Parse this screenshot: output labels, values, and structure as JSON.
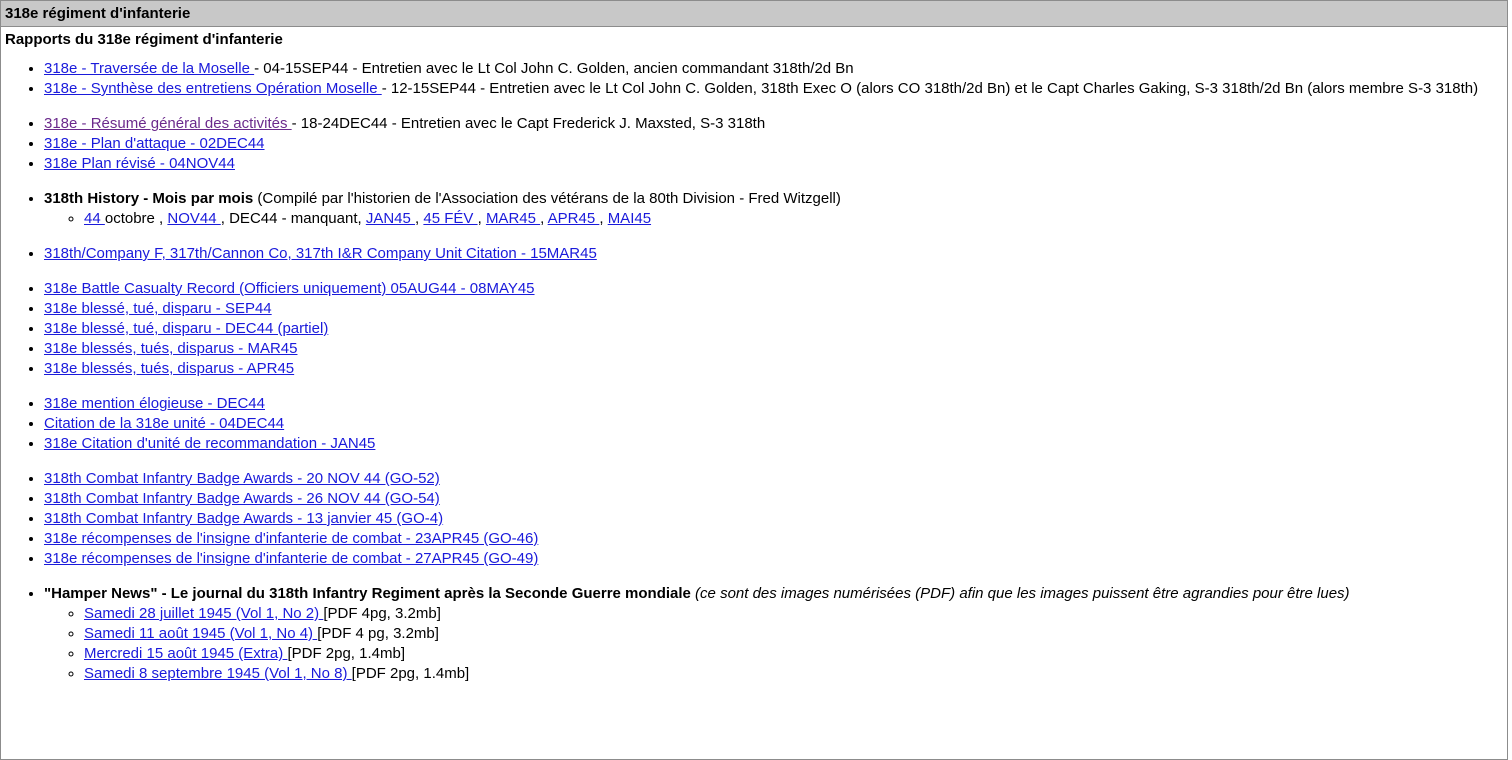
{
  "header": {
    "title": "318e régiment d'infanterie"
  },
  "section_title": "Rapports du 318e régiment d'infanterie",
  "moselle": [
    {
      "link": "318e - Traversée de la Moselle ",
      "text": "- 04-15SEP44 - Entretien avec le Lt Col John C. Golden, ancien commandant 318th/2d Bn"
    },
    {
      "link": "318e - Synthèse des entretiens Opération Moselle ",
      "text": "- 12-15SEP44 - Entretien avec le Lt Col John C. Golden, 318th Exec O (alors CO 318th/2d Bn) et le Capt Charles Gaking, S-3 318th/2d Bn (alors membre S-3 318th)"
    }
  ],
  "activities": [
    {
      "link": "318e - Résumé général des activités ",
      "text": "- 18-24DEC44 - Entretien avec le Capt Frederick J. Maxsted, S-3 318th"
    },
    {
      "link": "318e - Plan d'attaque - 02DEC44",
      "text": ""
    },
    {
      "link": "318e Plan révisé - 04NOV44",
      "text": ""
    }
  ],
  "history": {
    "title": "318th History - Mois par mois",
    "note": " (Compilé par l'historien de l'Association des vétérans de la 80th Division - Fred Witzgell)",
    "months": {
      "oct_link": "44 ",
      "oct_text": "octobre , ",
      "nov_link": "NOV44 ",
      "dec_text": ", DEC44 - manquant, ",
      "jan_link": "JAN45 ",
      "feb_link": "45 FÉV ",
      "mar_link": "MAR45 ",
      "apr_link": "APR45 ",
      "may_link": "MAI45",
      "sep": ", "
    }
  },
  "unit_citation": "318th/Company F, 317th/Cannon Co, 317th I&R Company Unit Citation - 15MAR45",
  "casualties": [
    "318e Battle Casualty Record (Officiers uniquement) 05AUG44 - 08MAY45",
    "318e blessé, tué, disparu - SEP44",
    "318e blessé, tué, disparu - DEC44 (partiel)",
    "318e blessés, tués, disparus - MAR45",
    "318e blessés, tués, disparus - APR45"
  ],
  "commendations": [
    "318e mention élogieuse - DEC44",
    "Citation de la 318e unité - 04DEC44",
    "318e Citation d'unité de recommandation - JAN45"
  ],
  "badges": [
    "318th Combat Infantry Badge Awards - 20 NOV 44 (GO-52)",
    "318th Combat Infantry Badge Awards - 26 NOV 44 (GO-54)",
    "318th Combat Infantry Badge Awards - 13 janvier 45 (GO-4)",
    "318e récompenses de l'insigne d'infanterie de combat - 23APR45 (GO-46)",
    "318e récompenses de l'insigne d'infanterie de combat - 27APR45 (GO-49)"
  ],
  "hamper": {
    "title": "\"Hamper News\" - Le journal du 318th Infantry Regiment après la Seconde Guerre mondiale",
    "note": " (ce sont des images numérisées (PDF) afin que les images puissent être agrandies pour être lues)",
    "issues": [
      {
        "link": "Samedi 28 juillet 1945 (Vol 1, No 2) ",
        "info": "[PDF 4pg, 3.2mb]"
      },
      {
        "link": "Samedi 11 août 1945 (Vol 1, No 4) ",
        "info": "[PDF 4 pg, 3.2mb]"
      },
      {
        "link": "Mercredi 15 août 1945 (Extra) ",
        "info": "[PDF 2pg, 1.4mb]"
      },
      {
        "link": "Samedi 8 septembre 1945 (Vol 1, No 8) ",
        "info": "[PDF 2pg, 1.4mb]"
      }
    ]
  }
}
